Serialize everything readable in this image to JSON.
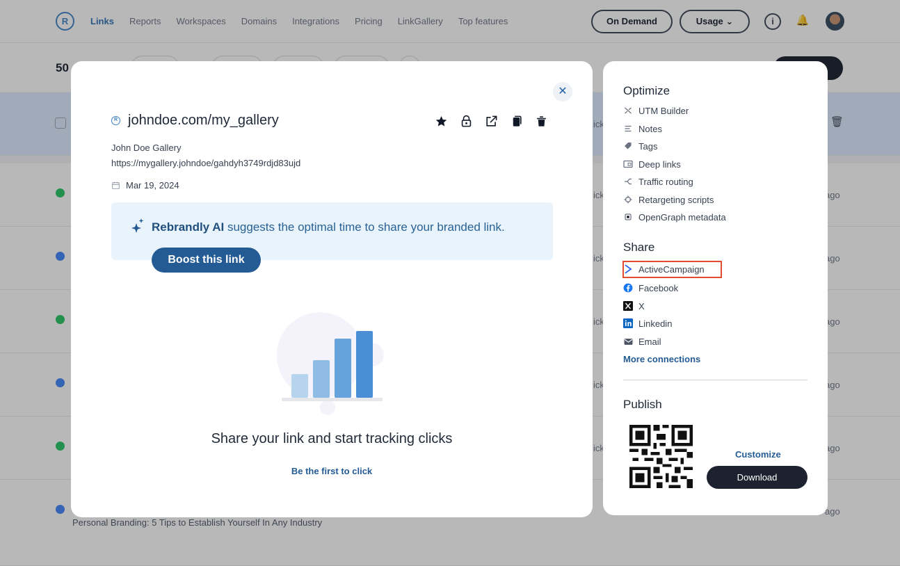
{
  "nav": {
    "logo": "R",
    "links": [
      "Links",
      "Reports",
      "Workspaces",
      "Domains",
      "Integrations",
      "Pricing",
      "LinkGallery",
      "Top features"
    ],
    "on_demand": "On Demand",
    "usage": "Usage ⌄",
    "info": "i",
    "bell": "🔔"
  },
  "list": {
    "count": "50",
    "rows": [
      {
        "frag": "ick",
        "ago": ""
      },
      {
        "frag": "ick",
        "ago": "ago"
      },
      {
        "frag": "ick",
        "ago": "ago"
      },
      {
        "frag": "ick",
        "ago": "ago"
      },
      {
        "frag": "ick",
        "ago": "ago"
      },
      {
        "frag": "ick",
        "ago": "ago"
      },
      {
        "frag": "",
        "ago": "ago",
        "title": "Personal Branding: 5 Tips to Establish Yourself In Any Industry"
      }
    ]
  },
  "modal": {
    "short_link": "johndoe.com/my_gallery",
    "title": "John Doe Gallery",
    "destination": "https://mygallery.johndoe/gahdyh3749rdjd83ujd",
    "date": "Mar 19, 2024",
    "ai_brand": "Rebrandly AI",
    "ai_text": " suggests the optimal time to share your branded link.",
    "boost_label": "Boost this link",
    "empty_title": "Share your link and start tracking clicks",
    "first_click": "Be the first to click",
    "close": "✕"
  },
  "panel": {
    "optimize_title": "Optimize",
    "optimize_items": [
      {
        "label": "UTM Builder",
        "icon": "utm-icon"
      },
      {
        "label": "Notes",
        "icon": "notes-icon"
      },
      {
        "label": "Tags",
        "icon": "tag-icon"
      },
      {
        "label": "Deep links",
        "icon": "deep-link-icon"
      },
      {
        "label": "Traffic routing",
        "icon": "routing-icon"
      },
      {
        "label": "Retargeting scripts",
        "icon": "target-icon"
      },
      {
        "label": "OpenGraph metadata",
        "icon": "opengraph-icon"
      }
    ],
    "share_title": "Share",
    "share_items": [
      {
        "label": "ActiveCampaign",
        "icon": "activecampaign-icon",
        "highlighted": true
      },
      {
        "label": "Facebook",
        "icon": "facebook-icon"
      },
      {
        "label": "X",
        "icon": "x-icon"
      },
      {
        "label": "Linkedin",
        "icon": "linkedin-icon"
      },
      {
        "label": "Email",
        "icon": "email-icon"
      }
    ],
    "more_connections": "More connections",
    "publish_title": "Publish",
    "customize": "Customize",
    "download": "Download"
  },
  "colors": {
    "accent": "#245b94",
    "highlight": "#e04d2f",
    "ai_box": "#e8f3fb"
  }
}
